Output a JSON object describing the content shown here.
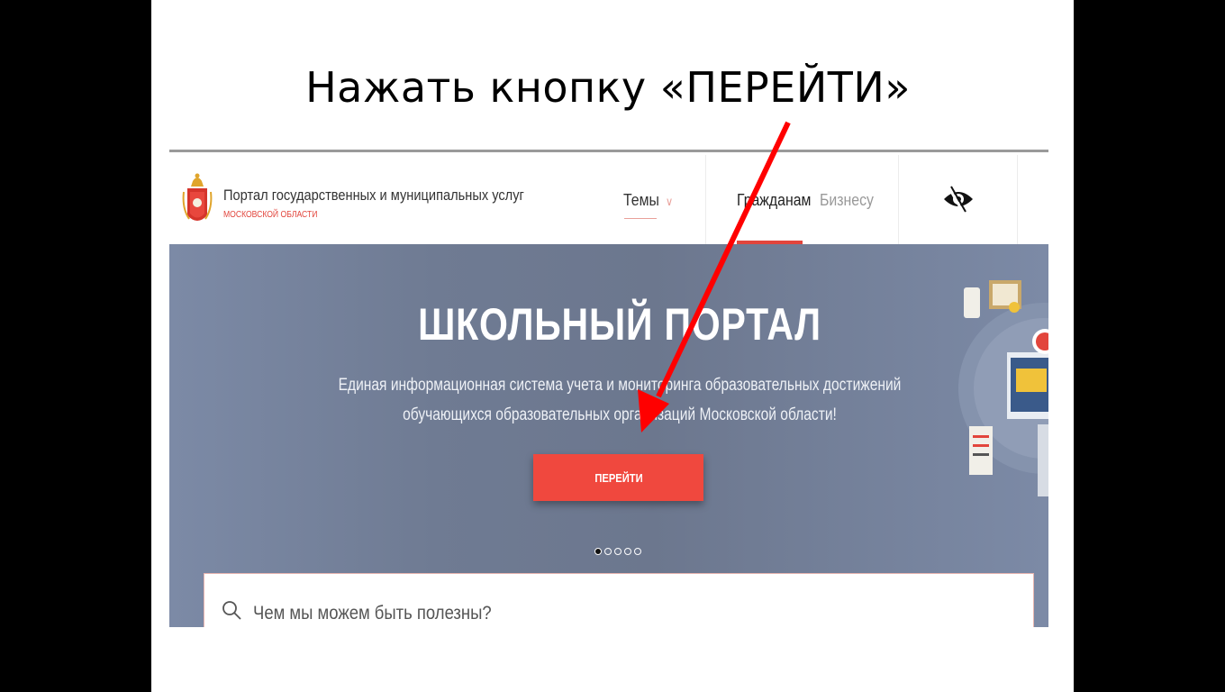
{
  "slide": {
    "instruction": "Нажать кнопку «ПЕРЕЙТИ»"
  },
  "header": {
    "portal_name": "Портал государственных и муниципальных услуг",
    "portal_region": "Московской области",
    "nav_themes": "Темы",
    "nav_citizens": "Гражданам",
    "nav_business": "Бизнесу",
    "accessibility_icon": "eye-icon"
  },
  "banner": {
    "title": "ШКОЛЬНЫЙ ПОРТАЛ",
    "subtitle_line1": "Единая информационная система учета и мониторинга образовательных достижений",
    "subtitle_line2": "обучающихся образовательных организаций Московской области!",
    "button_label": "ПЕРЕЙТИ",
    "slide_count": 5,
    "active_slide": 1
  },
  "search": {
    "placeholder": "Чем мы можем быть полезны?"
  },
  "colors": {
    "accent": "#f0483e",
    "arrow": "#ff0000",
    "banner_bg": "#6f7b93"
  }
}
